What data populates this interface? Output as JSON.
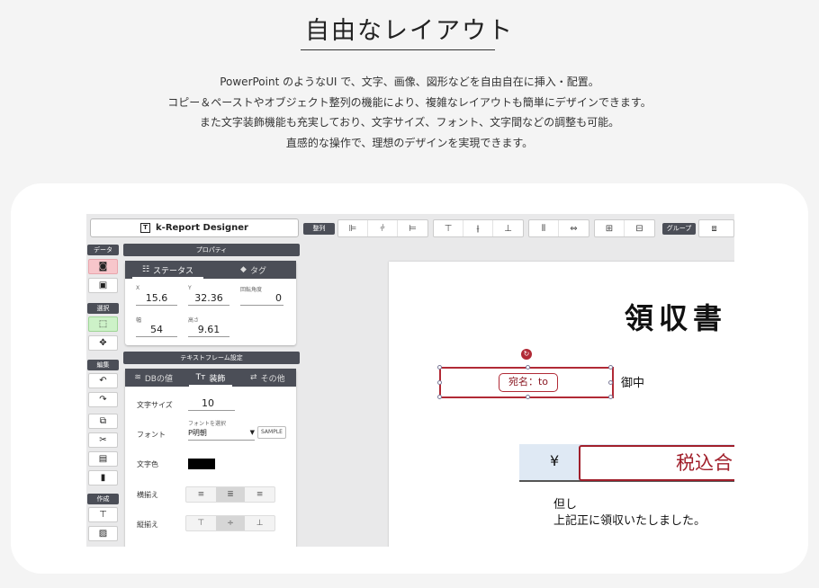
{
  "hero": {
    "title": "自由なレイアウト",
    "lines": [
      "PowerPoint のようなUI で、文字、画像、図形などを自由自在に挿入・配置。",
      "コピー＆ペーストやオブジェクト整列の機能により、複雑なレイアウトも簡単にデザインできます。",
      "また文字装飾機能も充実しており、文字サイズ、フォント、文字間などの調整も可能。",
      "直感的な操作で、理想のデザインを実現できます。"
    ]
  },
  "app": {
    "title": "k-Report Designer",
    "toolbar": {
      "align_label": "整列",
      "group_label": "グループ",
      "align_buttons": [
        "⊫",
        "⫩",
        "⊨"
      ],
      "valign_buttons": [
        "⊤",
        "⫲",
        "⊥"
      ],
      "distribute_buttons": [
        "⫴",
        "⇔"
      ],
      "grid_buttons": [
        "⊞",
        "⊟"
      ],
      "group_buttons": [
        "⧈"
      ]
    },
    "left_toolbar": {
      "data_label": "データ",
      "select_label": "選択",
      "edit_label": "編集",
      "create_label": "作成"
    },
    "properties": {
      "header": "プロパティ",
      "tab_status": "ステータス",
      "tab_tag": "タグ",
      "x_label": "X",
      "x_value": "15.6",
      "y_label": "Y",
      "y_value": "32.36",
      "rot_label": "回転角度",
      "rot_value": "0",
      "w_label": "幅",
      "w_value": "54",
      "h_label": "高さ",
      "h_value": "9.61"
    },
    "text_frame": {
      "header": "テキストフレーム設定",
      "tab_db": "DBの値",
      "tab_deco": "装飾",
      "tab_other": "その他",
      "font_size_label": "文字サイズ",
      "font_size_value": "10",
      "font_hint": "フォントを選択",
      "font_label": "フォント",
      "font_value": "P明朝",
      "sample_button": "SAMPLE",
      "color_label": "文字色",
      "color_value": "#000000",
      "halign_label": "横揃え",
      "valign_label": "縦揃え"
    },
    "document": {
      "title": "領収書",
      "address_field": "宛名：to",
      "honorific": "御中",
      "yen": "¥",
      "total_field": "税込合",
      "note_line1": "但し",
      "note_line2": "上記正に領収いたしました。",
      "accent": "#b12a36"
    }
  }
}
